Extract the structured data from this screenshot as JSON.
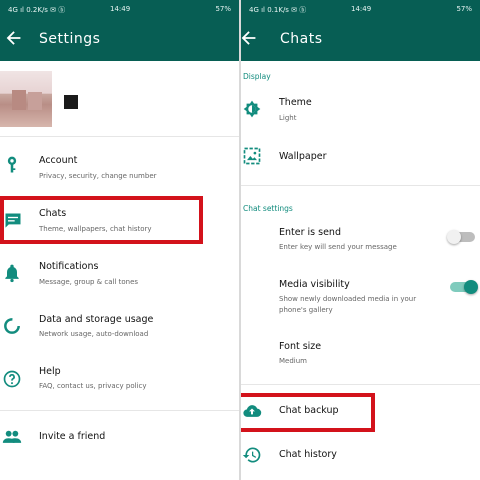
{
  "colors": {
    "appbar": "#075e54",
    "accent": "#128c7e",
    "highlight": "#d3121b"
  },
  "left": {
    "status": {
      "left": "4G ıl 0.2K/s ✉ ⓑ",
      "time": "14:49",
      "right": "57%"
    },
    "title": "Settings",
    "items": [
      {
        "icon": "key-icon",
        "title": "Account",
        "subtitle": "Privacy, security, change number"
      },
      {
        "icon": "chat-icon",
        "title": "Chats",
        "subtitle": "Theme, wallpapers, chat history"
      },
      {
        "icon": "bell-icon",
        "title": "Notifications",
        "subtitle": "Message, group & call tones"
      },
      {
        "icon": "data-usage-icon",
        "title": "Data and storage usage",
        "subtitle": "Network usage, auto-download"
      },
      {
        "icon": "help-icon",
        "title": "Help",
        "subtitle": "FAQ, contact us, privacy policy"
      },
      {
        "icon": "people-icon",
        "title": "Invite a friend",
        "subtitle": ""
      }
    ]
  },
  "right": {
    "status": {
      "left": "4G ıl 0.1K/s ✉ ⓑ",
      "time": "14:49",
      "right": "57%"
    },
    "title": "Chats",
    "display_label": "Display",
    "theme": {
      "icon": "theme-icon",
      "title": "Theme",
      "subtitle": "Light"
    },
    "wallpaper": {
      "icon": "wallpaper-icon",
      "title": "Wallpaper"
    },
    "chat_settings_label": "Chat settings",
    "enter_is_send": {
      "title": "Enter is send",
      "subtitle": "Enter key will send your message",
      "enabled": false
    },
    "media_visibility": {
      "title": "Media visibility",
      "subtitle_line1": "Show newly downloaded media in your",
      "subtitle_line2": "phone's gallery",
      "enabled": true
    },
    "font_size": {
      "title": "Font size",
      "subtitle": "Medium"
    },
    "chat_backup": {
      "icon": "cloud-upload-icon",
      "title": "Chat backup"
    },
    "chat_history": {
      "icon": "history-icon",
      "title": "Chat history"
    }
  }
}
